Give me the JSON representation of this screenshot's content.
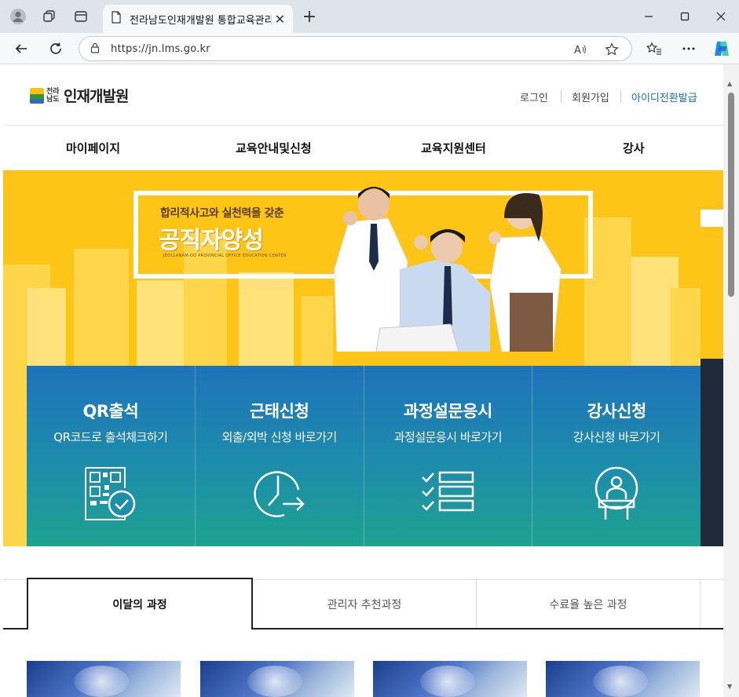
{
  "browser": {
    "tab_title": "전라남도인재개발원 통합교육관리시스템",
    "url": "https://jn.lms.go.kr"
  },
  "site": {
    "logo_small": "전라남도",
    "logo_main": "인재개발원",
    "util_links": [
      "로그인",
      "회원가입",
      "아이디전환발급"
    ],
    "util_colors": {
      "default": "#444444",
      "highlight": "#1a6fb3"
    }
  },
  "nav": {
    "items": [
      "마이페이지",
      "교육안내및신청",
      "교육지원센터",
      "강사"
    ]
  },
  "hero": {
    "subtitle": "합리적사고와 실천력을 갖춘",
    "title": "공직자양성",
    "english": "JEOLLANAM-DO PROVINCIAL OFFICE EDUCATION CENTER",
    "bg_color": "#fec516"
  },
  "quick_menu": [
    {
      "title": "QR출석",
      "sub": "QR코드로 출석체크하기",
      "icon": "qr-check-icon"
    },
    {
      "title": "근태신청",
      "sub": "외출/외박 신청 바로가기",
      "icon": "clock-arrow-icon"
    },
    {
      "title": "과정설문응시",
      "sub": "과정설문응시 바로가기",
      "icon": "checklist-icon"
    },
    {
      "title": "강사신청",
      "sub": "강사신청 바로가기",
      "icon": "lecturer-podium-icon"
    }
  ],
  "course_tabs": {
    "items": [
      "이달의 과정",
      "관리자 추천과정",
      "수료율 높은 과정"
    ],
    "active_index": 0
  }
}
